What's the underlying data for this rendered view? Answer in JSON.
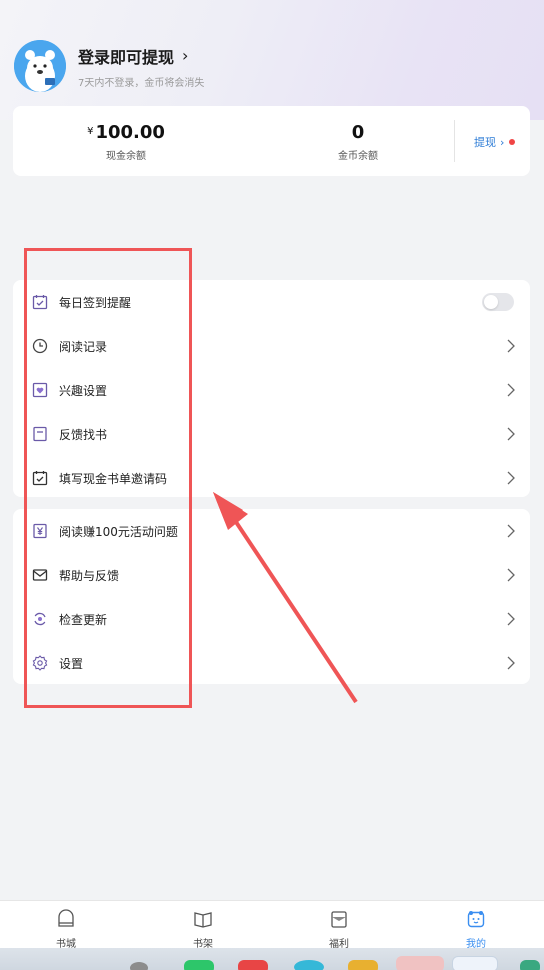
{
  "profile": {
    "title": "登录即可提现",
    "subtitle": "7天内不登录，金币将会消失"
  },
  "balance": {
    "cash_symbol": "¥",
    "cash_value": "100.00",
    "cash_label": "现金余额",
    "coin_value": "0",
    "coin_label": "金币余额",
    "withdraw_label": "提现"
  },
  "menu_group1": [
    {
      "label": "每日签到提醒",
      "icon": "calendar-check-icon"
    },
    {
      "label": "阅读记录",
      "icon": "clock-icon"
    },
    {
      "label": "兴趣设置",
      "icon": "heart-icon"
    },
    {
      "label": "反馈找书",
      "icon": "document-icon"
    },
    {
      "label": "填写现金书单邀请码",
      "icon": "calendar-check-icon"
    }
  ],
  "menu_group2": [
    {
      "label": "阅读赚100元活动问题",
      "icon": "yen-icon"
    },
    {
      "label": "帮助与反馈",
      "icon": "mail-icon"
    },
    {
      "label": "检查更新",
      "icon": "refresh-icon"
    },
    {
      "label": "设置",
      "icon": "gear-icon"
    }
  ],
  "tabs": [
    {
      "label": "书城",
      "icon": "bookstore-icon"
    },
    {
      "label": "书架",
      "icon": "bookshelf-icon"
    },
    {
      "label": "福利",
      "icon": "gift-icon"
    },
    {
      "label": "我的",
      "icon": "profile-icon",
      "active": true
    }
  ],
  "colors": {
    "accent": "#3a8ef0",
    "annotation": "#ef5556",
    "icon_purple": "#6a5aa8"
  }
}
